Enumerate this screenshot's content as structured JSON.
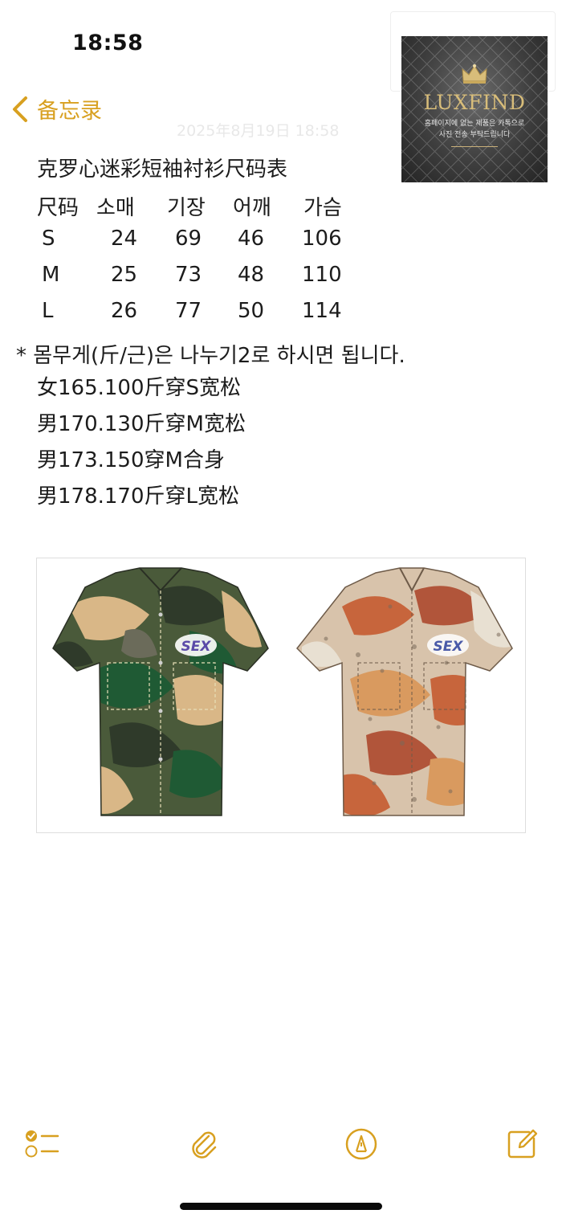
{
  "status_bar": {
    "time": "18:58"
  },
  "nav": {
    "back_label": "备忘录",
    "ghost_date": "2025年8月19日 18:58"
  },
  "watermark": {
    "brand": "LUXFIND",
    "line1": "홈페이지에 없는 제품은 카톡으로",
    "line2": "사진 전송 부탁드립니다"
  },
  "note": {
    "title": "克罗心迷彩短袖衬衫尺码表",
    "size_table": {
      "headers": [
        "尺码",
        "소매",
        "기장",
        "어깨",
        "가슴"
      ],
      "rows": [
        [
          "S",
          "24",
          "69",
          "46",
          "106"
        ],
        [
          "M",
          "25",
          "73",
          "48",
          "110"
        ],
        [
          "L",
          "26",
          "77",
          "50",
          "114"
        ]
      ]
    },
    "weight_note": "* 몸무게(斤/근)은 나누기2로 하시면 됩니다.",
    "fit_lines": [
      "女165.100斤穿S宽松",
      "男170.130斤穿M宽松",
      "男173.150穿M合身",
      "男178.170斤穿L宽松"
    ]
  },
  "product_image": {
    "badge_text": "SEX",
    "shirts": [
      "green-camo-shirt",
      "desert-camo-shirt"
    ]
  },
  "toolbar": {
    "icons": [
      "checklist-icon",
      "paperclip-icon",
      "markup-pen-icon",
      "compose-icon"
    ]
  },
  "colors": {
    "accent": "#d8a020",
    "text": "#1c1c1c",
    "background": "#ffffff"
  }
}
